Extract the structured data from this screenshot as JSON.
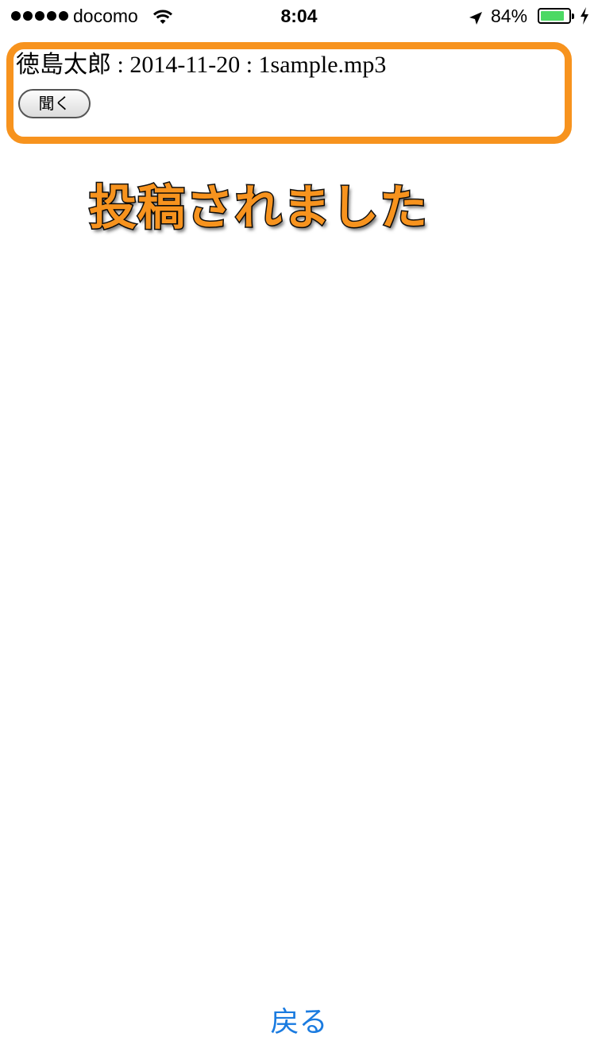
{
  "status_bar": {
    "carrier": "docomo",
    "time": "8:04",
    "battery_percent": "84%",
    "battery_level": 0.84,
    "icons": [
      "signal-dots-icon",
      "wifi-icon",
      "location-arrow-icon",
      "battery-icon",
      "charging-bolt-icon"
    ]
  },
  "entry": {
    "text": "徳島太郎 : 2014-11-20 : 1sample.mp3",
    "listen_label": "聞く",
    "highlight_color": "#f7931e"
  },
  "annotation": {
    "text": "投稿されました",
    "color": "#f7931e"
  },
  "footer": {
    "back_label": "戻る",
    "link_color": "#1a7be0"
  }
}
